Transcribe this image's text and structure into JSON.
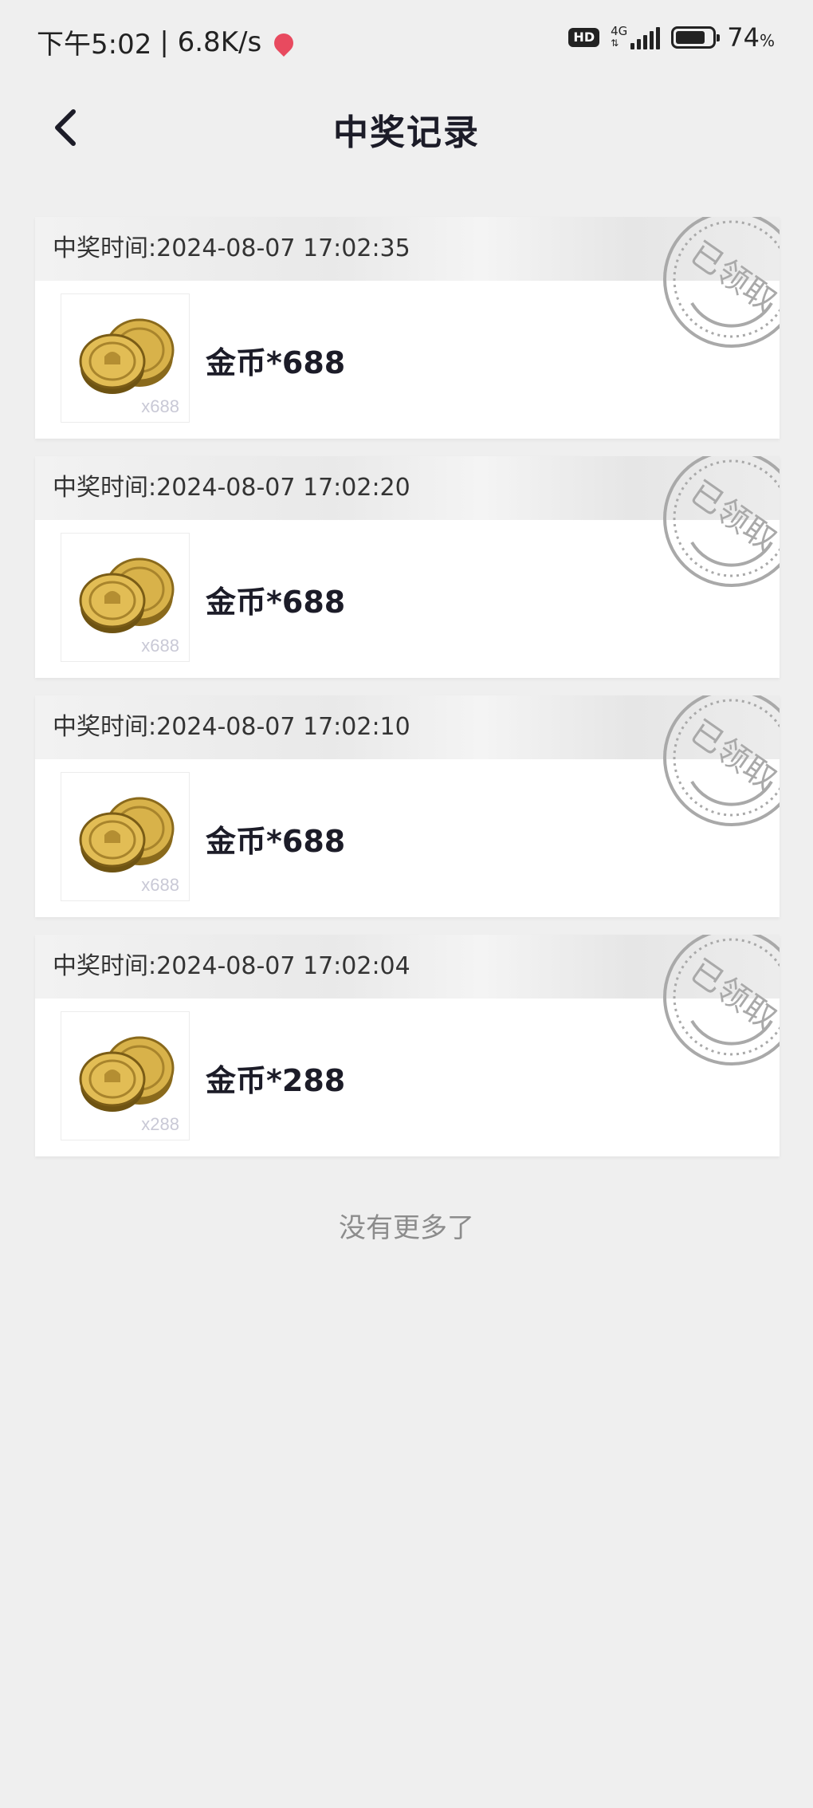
{
  "status_bar": {
    "time": "下午5:02",
    "speed": "| 6.8K/s",
    "hd": "HD",
    "network": "4G",
    "battery_percent": "74",
    "battery_unit": "%"
  },
  "header": {
    "title": "中奖记录"
  },
  "records": [
    {
      "time_label": "中奖时间:2024-08-07 17:02:35",
      "prize_name": "金币*688",
      "thumb_qty": "x688",
      "stamp_text": "已领取"
    },
    {
      "time_label": "中奖时间:2024-08-07 17:02:20",
      "prize_name": "金币*688",
      "thumb_qty": "x688",
      "stamp_text": "已领取"
    },
    {
      "time_label": "中奖时间:2024-08-07 17:02:10",
      "prize_name": "金币*688",
      "thumb_qty": "x688",
      "stamp_text": "已领取"
    },
    {
      "time_label": "中奖时间:2024-08-07 17:02:04",
      "prize_name": "金币*288",
      "thumb_qty": "x288",
      "stamp_text": "已领取"
    }
  ],
  "footer": {
    "no_more": "没有更多了"
  },
  "colors": {
    "background": "#efefef",
    "title": "#1c1c28",
    "stamp": "#a9a9a9",
    "coin_gold": "#c9a23c"
  },
  "icons": {
    "back": "chevron-left-icon",
    "prize": "gold-coins-icon",
    "stamp": "claimed-stamp-icon"
  }
}
